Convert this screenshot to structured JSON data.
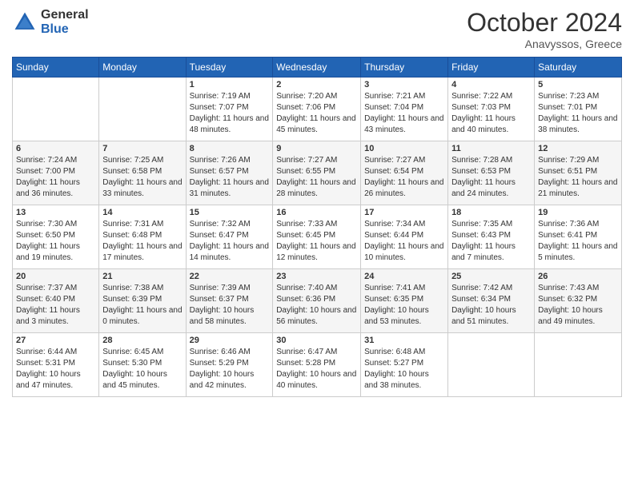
{
  "header": {
    "logo_general": "General",
    "logo_blue": "Blue",
    "month": "October 2024",
    "location": "Anavyssos, Greece"
  },
  "days_of_week": [
    "Sunday",
    "Monday",
    "Tuesday",
    "Wednesday",
    "Thursday",
    "Friday",
    "Saturday"
  ],
  "weeks": [
    [
      {
        "day": "",
        "text": ""
      },
      {
        "day": "",
        "text": ""
      },
      {
        "day": "1",
        "text": "Sunrise: 7:19 AM\nSunset: 7:07 PM\nDaylight: 11 hours and 48 minutes."
      },
      {
        "day": "2",
        "text": "Sunrise: 7:20 AM\nSunset: 7:06 PM\nDaylight: 11 hours and 45 minutes."
      },
      {
        "day": "3",
        "text": "Sunrise: 7:21 AM\nSunset: 7:04 PM\nDaylight: 11 hours and 43 minutes."
      },
      {
        "day": "4",
        "text": "Sunrise: 7:22 AM\nSunset: 7:03 PM\nDaylight: 11 hours and 40 minutes."
      },
      {
        "day": "5",
        "text": "Sunrise: 7:23 AM\nSunset: 7:01 PM\nDaylight: 11 hours and 38 minutes."
      }
    ],
    [
      {
        "day": "6",
        "text": "Sunrise: 7:24 AM\nSunset: 7:00 PM\nDaylight: 11 hours and 36 minutes."
      },
      {
        "day": "7",
        "text": "Sunrise: 7:25 AM\nSunset: 6:58 PM\nDaylight: 11 hours and 33 minutes."
      },
      {
        "day": "8",
        "text": "Sunrise: 7:26 AM\nSunset: 6:57 PM\nDaylight: 11 hours and 31 minutes."
      },
      {
        "day": "9",
        "text": "Sunrise: 7:27 AM\nSunset: 6:55 PM\nDaylight: 11 hours and 28 minutes."
      },
      {
        "day": "10",
        "text": "Sunrise: 7:27 AM\nSunset: 6:54 PM\nDaylight: 11 hours and 26 minutes."
      },
      {
        "day": "11",
        "text": "Sunrise: 7:28 AM\nSunset: 6:53 PM\nDaylight: 11 hours and 24 minutes."
      },
      {
        "day": "12",
        "text": "Sunrise: 7:29 AM\nSunset: 6:51 PM\nDaylight: 11 hours and 21 minutes."
      }
    ],
    [
      {
        "day": "13",
        "text": "Sunrise: 7:30 AM\nSunset: 6:50 PM\nDaylight: 11 hours and 19 minutes."
      },
      {
        "day": "14",
        "text": "Sunrise: 7:31 AM\nSunset: 6:48 PM\nDaylight: 11 hours and 17 minutes."
      },
      {
        "day": "15",
        "text": "Sunrise: 7:32 AM\nSunset: 6:47 PM\nDaylight: 11 hours and 14 minutes."
      },
      {
        "day": "16",
        "text": "Sunrise: 7:33 AM\nSunset: 6:45 PM\nDaylight: 11 hours and 12 minutes."
      },
      {
        "day": "17",
        "text": "Sunrise: 7:34 AM\nSunset: 6:44 PM\nDaylight: 11 hours and 10 minutes."
      },
      {
        "day": "18",
        "text": "Sunrise: 7:35 AM\nSunset: 6:43 PM\nDaylight: 11 hours and 7 minutes."
      },
      {
        "day": "19",
        "text": "Sunrise: 7:36 AM\nSunset: 6:41 PM\nDaylight: 11 hours and 5 minutes."
      }
    ],
    [
      {
        "day": "20",
        "text": "Sunrise: 7:37 AM\nSunset: 6:40 PM\nDaylight: 11 hours and 3 minutes."
      },
      {
        "day": "21",
        "text": "Sunrise: 7:38 AM\nSunset: 6:39 PM\nDaylight: 11 hours and 0 minutes."
      },
      {
        "day": "22",
        "text": "Sunrise: 7:39 AM\nSunset: 6:37 PM\nDaylight: 10 hours and 58 minutes."
      },
      {
        "day": "23",
        "text": "Sunrise: 7:40 AM\nSunset: 6:36 PM\nDaylight: 10 hours and 56 minutes."
      },
      {
        "day": "24",
        "text": "Sunrise: 7:41 AM\nSunset: 6:35 PM\nDaylight: 10 hours and 53 minutes."
      },
      {
        "day": "25",
        "text": "Sunrise: 7:42 AM\nSunset: 6:34 PM\nDaylight: 10 hours and 51 minutes."
      },
      {
        "day": "26",
        "text": "Sunrise: 7:43 AM\nSunset: 6:32 PM\nDaylight: 10 hours and 49 minutes."
      }
    ],
    [
      {
        "day": "27",
        "text": "Sunrise: 6:44 AM\nSunset: 5:31 PM\nDaylight: 10 hours and 47 minutes."
      },
      {
        "day": "28",
        "text": "Sunrise: 6:45 AM\nSunset: 5:30 PM\nDaylight: 10 hours and 45 minutes."
      },
      {
        "day": "29",
        "text": "Sunrise: 6:46 AM\nSunset: 5:29 PM\nDaylight: 10 hours and 42 minutes."
      },
      {
        "day": "30",
        "text": "Sunrise: 6:47 AM\nSunset: 5:28 PM\nDaylight: 10 hours and 40 minutes."
      },
      {
        "day": "31",
        "text": "Sunrise: 6:48 AM\nSunset: 5:27 PM\nDaylight: 10 hours and 38 minutes."
      },
      {
        "day": "",
        "text": ""
      },
      {
        "day": "",
        "text": ""
      }
    ]
  ]
}
